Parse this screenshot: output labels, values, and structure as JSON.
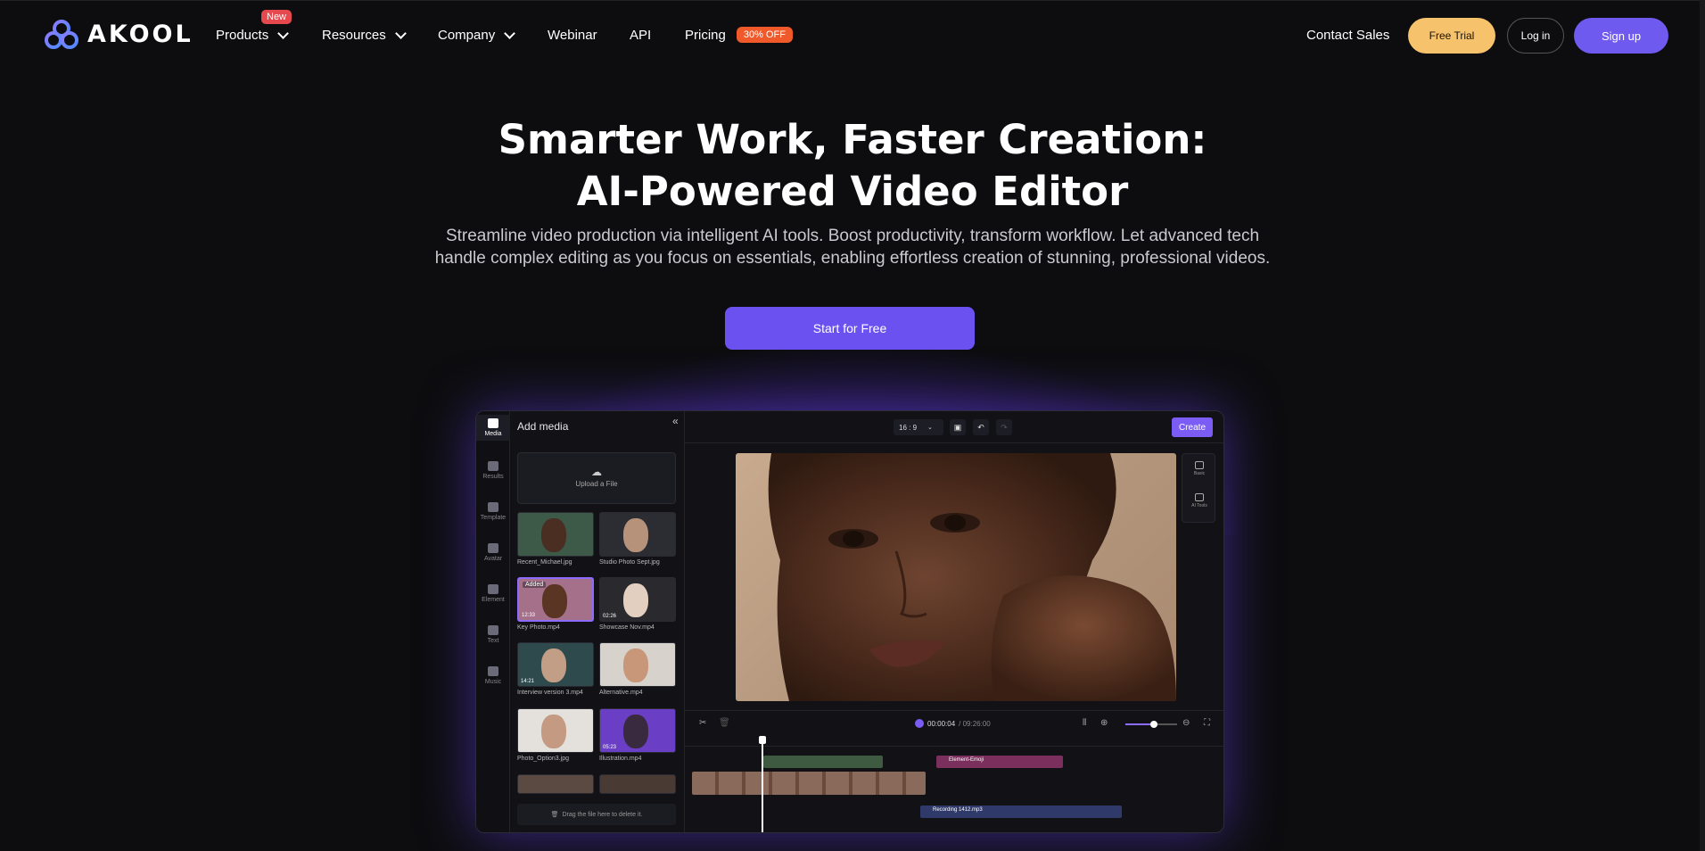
{
  "nav": {
    "brand": "AKOOL",
    "products": "Products",
    "products_badge": "New",
    "resources": "Resources",
    "company": "Company",
    "webinar": "Webinar",
    "api": "API",
    "pricing": "Pricing",
    "pricing_badge": "30% OFF",
    "contact": "Contact Sales",
    "free_trial": "Free Trial",
    "login": "Log in",
    "signup": "Sign up"
  },
  "hero": {
    "title_line1": "Smarter Work, Faster Creation:",
    "title_line2": "AI-Powered Video Editor",
    "subtitle_line1": "Streamline video production via intelligent AI tools. Boost productivity, transform workflow. Let advanced tech",
    "subtitle_line2": "handle complex editing as you focus on essentials, enabling effortless creation of stunning, professional videos.",
    "cta": "Start for Free"
  },
  "editor": {
    "rail": [
      "Media",
      "Results",
      "Template",
      "Avatar",
      "Element",
      "Text",
      "Music"
    ],
    "media_title": "Add media",
    "upload_label": "Upload a File",
    "items": [
      {
        "label": "Recent_Michael.jpg",
        "duration": "",
        "tag": ""
      },
      {
        "label": "Studio Photo Sept.jpg",
        "duration": "",
        "tag": ""
      },
      {
        "label": "Key Photo.mp4",
        "duration": "12:33",
        "tag": "Added"
      },
      {
        "label": "Showcase Nov.mp4",
        "duration": "02:26",
        "tag": ""
      },
      {
        "label": "Interview version 3.mp4",
        "duration": "14:21",
        "tag": ""
      },
      {
        "label": "Alternative.mp4",
        "duration": "",
        "tag": ""
      },
      {
        "label": "Photo_Option3.jpg",
        "duration": "",
        "tag": ""
      },
      {
        "label": "Illustration.mp4",
        "duration": "05:23",
        "tag": ""
      }
    ],
    "drop_label": "Drag the file here to delete it.",
    "ratio": "16 : 9",
    "create": "Create",
    "side_tools": [
      "Basic",
      "AI Tools"
    ],
    "time_current": "00:00:04",
    "time_total": "/ 09:26:00",
    "zoom_level": 0.55,
    "tracks": {
      "element": "Element-Emoji",
      "audio": "Recording 1412.mp3"
    }
  },
  "colors": {
    "accent": "#6f5af0",
    "trial": "#f6c26b",
    "badge_new": "#e5484d",
    "badge_off": "#f05a2a"
  }
}
